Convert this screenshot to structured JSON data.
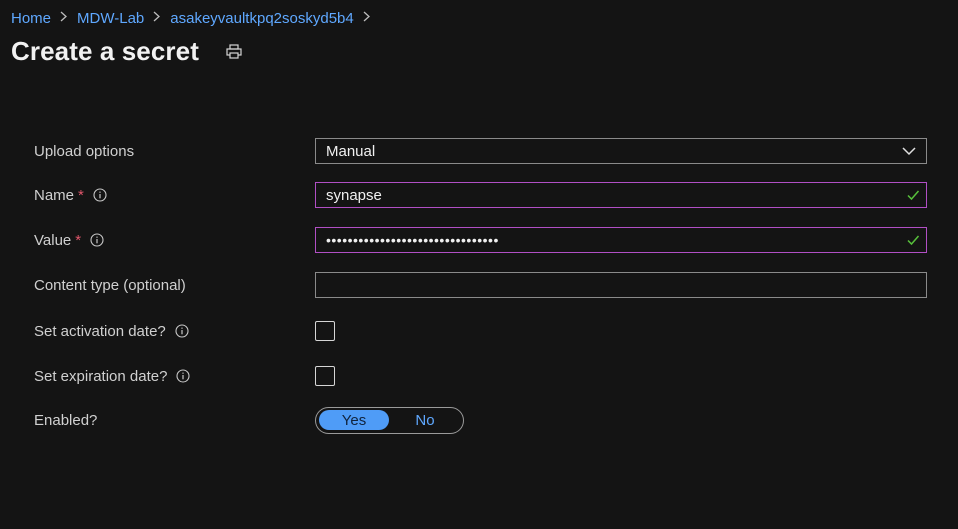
{
  "breadcrumb": {
    "items": [
      "Home",
      "MDW-Lab",
      "asakeyvaultkpq2soskyd5b4"
    ],
    "separator": ">"
  },
  "page": {
    "title": "Create a secret",
    "print_icon": "print-icon"
  },
  "form": {
    "upload_options": {
      "label": "Upload options",
      "value": "Manual"
    },
    "name": {
      "label": "Name",
      "required_mark": "*",
      "value": "synapse",
      "valid": true
    },
    "value": {
      "label": "Value",
      "required_mark": "*",
      "value": "••••••••••••••••••••••••••••••••",
      "valid": true
    },
    "content_type": {
      "label": "Content type (optional)",
      "value": ""
    },
    "activation_date": {
      "label": "Set activation date?",
      "checked": false
    },
    "expiration_date": {
      "label": "Set expiration date?",
      "checked": false
    },
    "enabled": {
      "label": "Enabled?",
      "yes": "Yes",
      "no": "No",
      "selected": "Yes"
    }
  },
  "colors": {
    "background": "#141414",
    "link": "#5fa8ff",
    "required": "#e0566b",
    "valid_border": "#b14fc5",
    "check": "#57c03b",
    "toggle_on": "#4f9cf7"
  }
}
